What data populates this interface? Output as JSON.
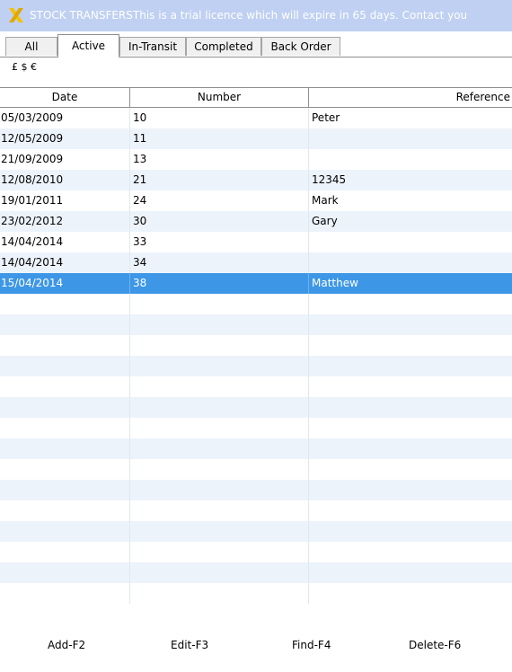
{
  "window": {
    "title": "STOCK TRANSFERSThis is a trial licence which will expire in 65 days. Contact you",
    "logo_icon": "x-logo-icon",
    "titlebar_color": "#bfd0f2"
  },
  "tabs": [
    {
      "label": "All",
      "active": false
    },
    {
      "label": "Active",
      "active": true
    },
    {
      "label": "In-Transit",
      "active": false
    },
    {
      "label": "Completed",
      "active": false
    },
    {
      "label": "Back Order",
      "active": false
    }
  ],
  "currency_symbols": "£ $ €",
  "table": {
    "columns": [
      "Date",
      "Number",
      "Reference"
    ],
    "rows": [
      {
        "date": "05/03/2009",
        "number": "10",
        "reference": "Peter"
      },
      {
        "date": "12/05/2009",
        "number": "11",
        "reference": ""
      },
      {
        "date": "21/09/2009",
        "number": "13",
        "reference": ""
      },
      {
        "date": "12/08/2010",
        "number": "21",
        "reference": "12345"
      },
      {
        "date": "19/01/2011",
        "number": "24",
        "reference": "Mark"
      },
      {
        "date": "23/02/2012",
        "number": "30",
        "reference": "Gary"
      },
      {
        "date": "14/04/2014",
        "number": "33",
        "reference": ""
      },
      {
        "date": "14/04/2014",
        "number": "34",
        "reference": ""
      },
      {
        "date": "15/04/2014",
        "number": "38",
        "reference": "Matthew"
      }
    ],
    "selected_row": 8,
    "selection_color": "#3d97e6",
    "alt_row_color": "#edf3fb"
  },
  "footer": {
    "buttons": [
      "Add-F2",
      "Edit-F3",
      "Find-F4",
      "Delete-F6"
    ]
  }
}
